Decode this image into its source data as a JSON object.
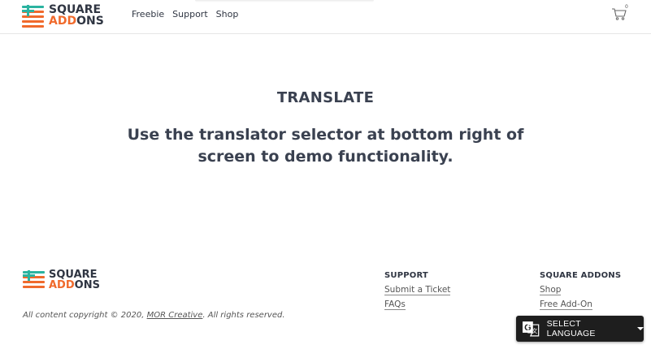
{
  "brand": {
    "line1": "SQUARE",
    "line2_a": "ADD",
    "line2_b": "ONS"
  },
  "nav": {
    "items": [
      "Freebie",
      "Support",
      "Shop"
    ]
  },
  "cart": {
    "count": "0"
  },
  "main": {
    "title": "TRANSLATE",
    "message": "Use the translator selector at bottom right of screen to demo functionality."
  },
  "footer": {
    "copyright_prefix": "All content copyright © 2020,",
    "copyright_link": "MOR Creative",
    "copyright_suffix": ". All rights reserved.",
    "support": {
      "heading": "SUPPORT",
      "links": [
        "Submit a Ticket",
        "FAQs"
      ]
    },
    "addons": {
      "heading": "SQUARE ADDONS",
      "links": [
        "Shop",
        "Free Add-On"
      ]
    }
  },
  "translate_widget": {
    "label": "SELECT LANGUAGE"
  },
  "colors": {
    "brand_orange": "#f06a2c",
    "brand_teal": "#2bb3a0",
    "text_dark": "#2f3542",
    "widget_bg": "#1e1e1e"
  }
}
